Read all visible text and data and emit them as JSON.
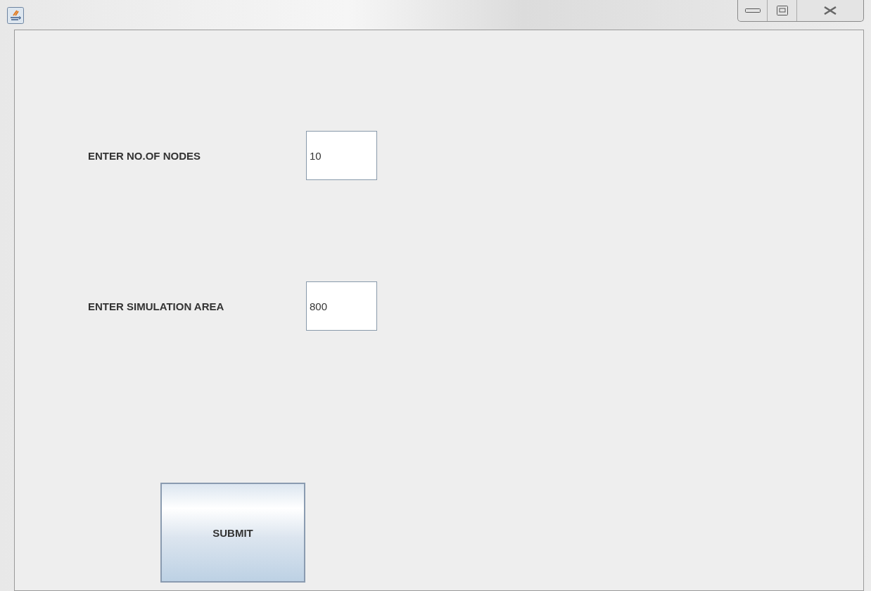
{
  "fields": [
    {
      "label": "ENTER NO.OF NODES",
      "value": "10"
    },
    {
      "label": "ENTER SIMULATION AREA",
      "value": "800"
    }
  ],
  "submit_button": {
    "label": "SUBMIT"
  }
}
